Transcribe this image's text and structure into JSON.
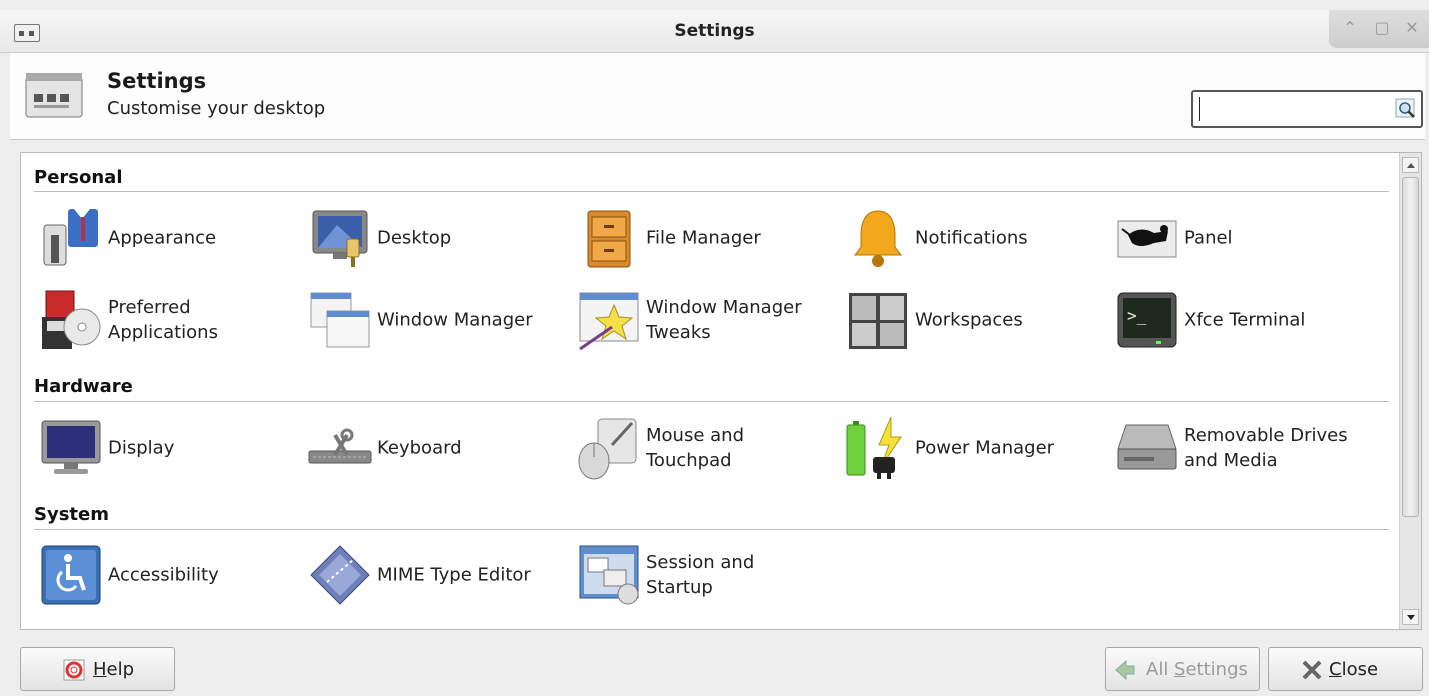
{
  "window": {
    "title": "Settings",
    "controls": [
      "minimize",
      "maximize",
      "close"
    ]
  },
  "header": {
    "title": "Settings",
    "subtitle": "Customise your desktop",
    "search": {
      "value": "",
      "placeholder": ""
    }
  },
  "sections": [
    {
      "title": "Personal",
      "items": [
        {
          "label": "Appearance",
          "icon": "appearance-icon"
        },
        {
          "label": "Desktop",
          "icon": "desktop-icon"
        },
        {
          "label": "File Manager",
          "icon": "file-manager-icon"
        },
        {
          "label": "Notifications",
          "icon": "bell-icon"
        },
        {
          "label": "Panel",
          "icon": "panel-icon"
        },
        {
          "label": "Preferred\nApplications",
          "icon": "preferred-applications-icon"
        },
        {
          "label": "Window Manager",
          "icon": "window-manager-icon"
        },
        {
          "label": "Window Manager\nTweaks",
          "icon": "window-manager-tweaks-icon"
        },
        {
          "label": "Workspaces",
          "icon": "workspaces-icon"
        },
        {
          "label": "Xfce Terminal",
          "icon": "terminal-icon"
        }
      ]
    },
    {
      "title": "Hardware",
      "items": [
        {
          "label": "Display",
          "icon": "display-icon"
        },
        {
          "label": "Keyboard",
          "icon": "keyboard-icon"
        },
        {
          "label": "Mouse and\nTouchpad",
          "icon": "mouse-icon"
        },
        {
          "label": "Power Manager",
          "icon": "battery-icon"
        },
        {
          "label": "Removable Drives\nand Media",
          "icon": "drive-icon"
        }
      ]
    },
    {
      "title": "System",
      "items": [
        {
          "label": "Accessibility",
          "icon": "accessibility-icon"
        },
        {
          "label": "MIME Type Editor",
          "icon": "mime-icon"
        },
        {
          "label": "Session and\nStartup",
          "icon": "session-icon"
        }
      ]
    }
  ],
  "footer": {
    "help": {
      "label": "Help",
      "mnemonic": "H"
    },
    "all_settings": {
      "label": "All Settings",
      "mnemonic": "S",
      "enabled": false
    },
    "close": {
      "label": "Close",
      "mnemonic": "C"
    }
  },
  "colors": {
    "accent": "#3b6fb6",
    "background": "#ededed"
  }
}
